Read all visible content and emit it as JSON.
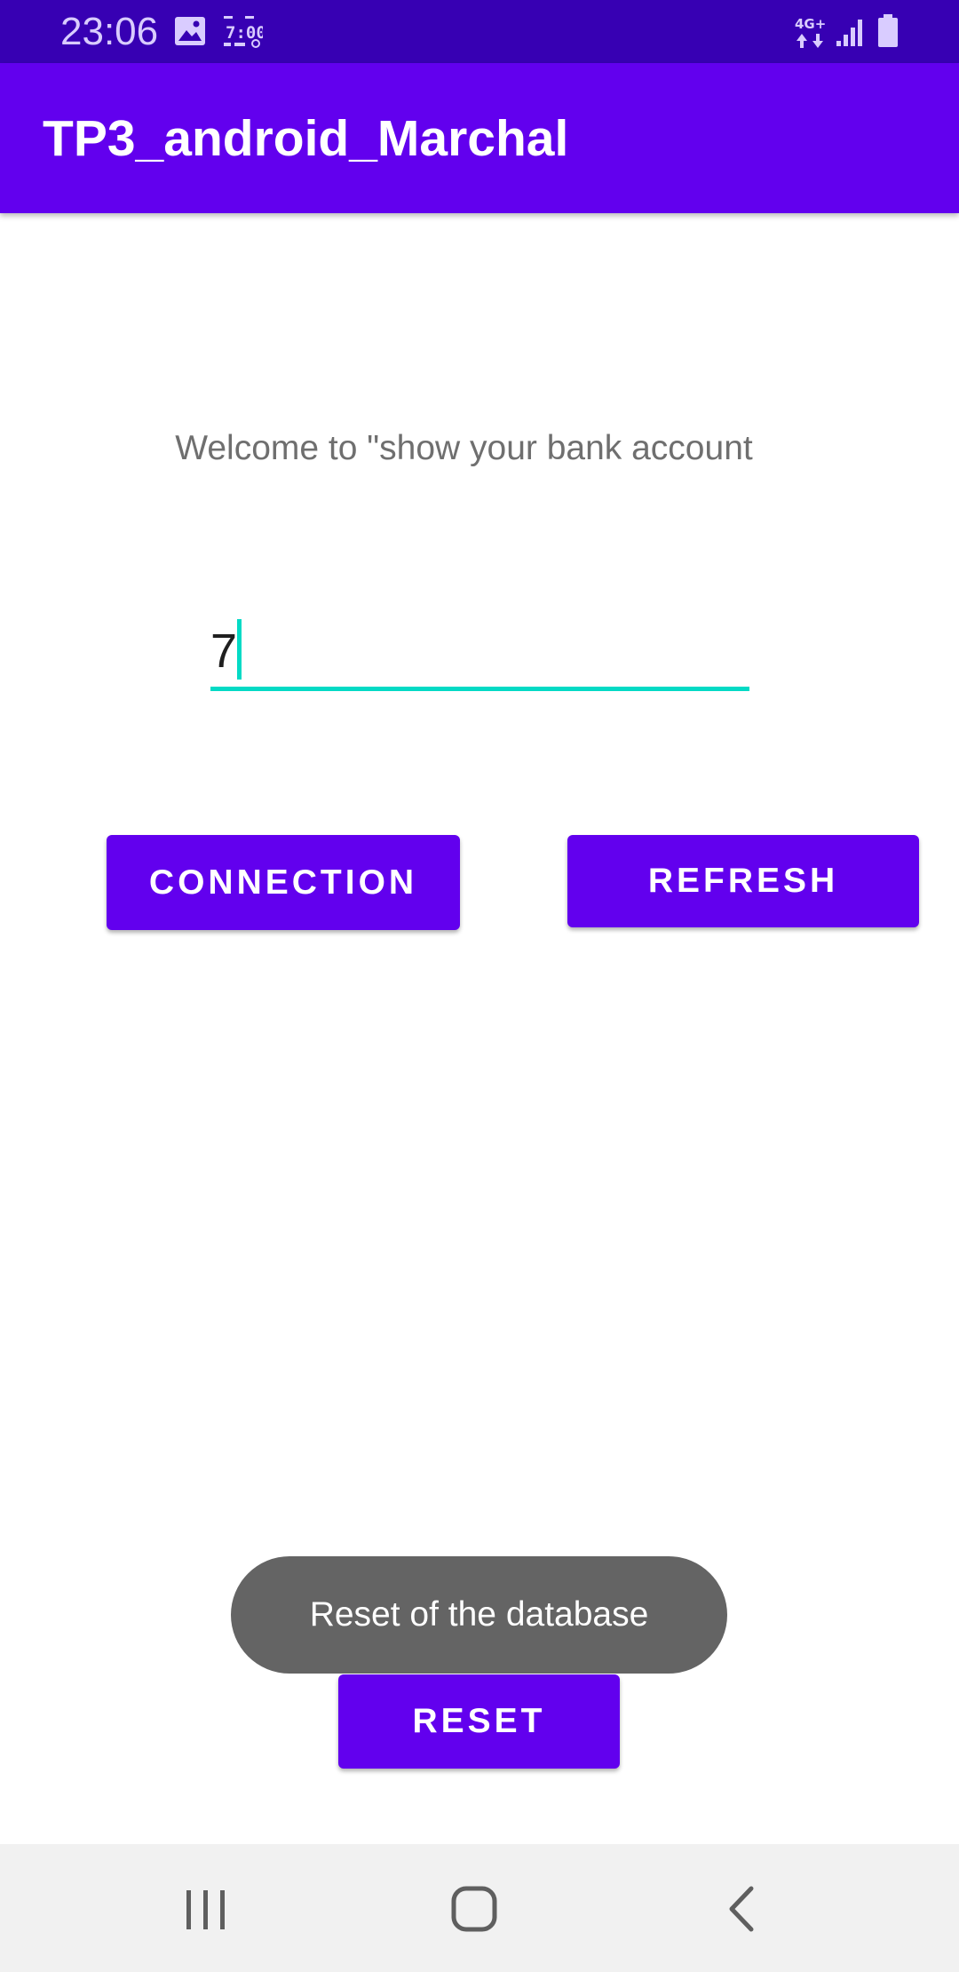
{
  "status_bar": {
    "time": "23:06",
    "icons": [
      "gallery-icon",
      "clock-widget-icon",
      "network-4g-icon",
      "signal-icon",
      "battery-icon"
    ],
    "network_label": "4G+"
  },
  "app_bar": {
    "title": "TP3_android_Marchal"
  },
  "content": {
    "welcome_text": "Welcome to \"show your bank account",
    "account_input": {
      "value": "7"
    },
    "connection_button": "CONNECTION",
    "refresh_button": "REFRESH",
    "reset_button": "RESET",
    "toast": "Reset of the database"
  },
  "nav_bar": {
    "icons": [
      "recents-icon",
      "home-icon",
      "back-icon"
    ]
  },
  "colors": {
    "status_bar": "#3700B3",
    "primary": "#6200EE",
    "accent": "#03DAC5",
    "toast": "#646464",
    "nav_bar": "#F1F1F1"
  }
}
